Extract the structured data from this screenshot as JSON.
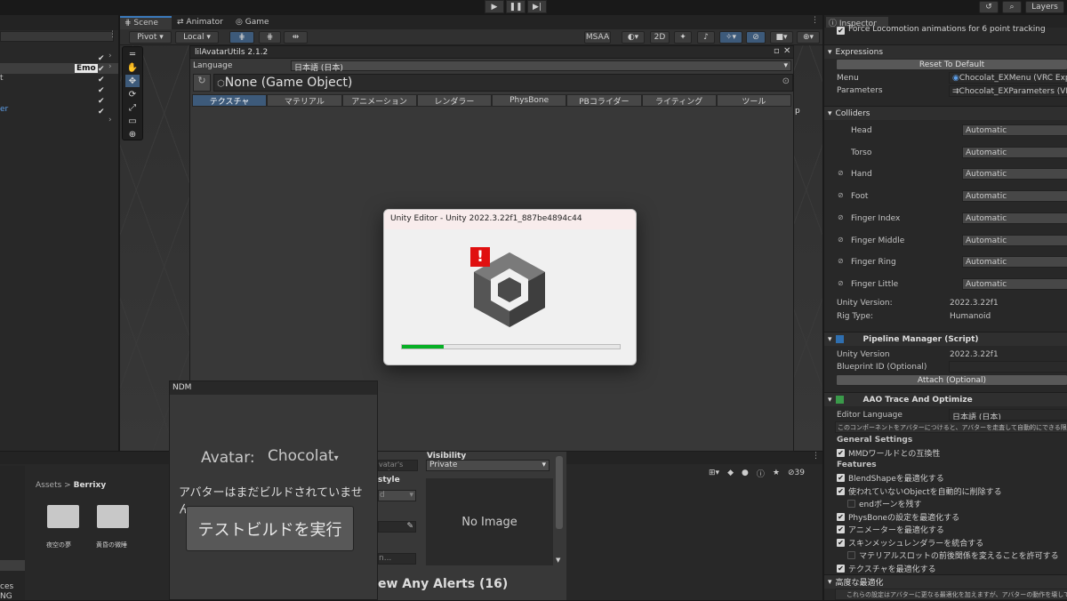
{
  "topbar": {
    "layers_label": "Layers",
    "play_icon": "play-icon",
    "pause_icon": "pause-icon",
    "step_icon": "step-icon"
  },
  "tabs": {
    "scene": "Scene",
    "animator": "Animator",
    "game": "Game",
    "inspector": "Inspector"
  },
  "scene_toolbar": {
    "pivot": "Pivot",
    "local": "Local",
    "msaa": "MSAA",
    "mode_2d": "2D",
    "visibility_count": "39"
  },
  "hierarchy": {
    "item_label": "Emo",
    "fragment_t": "t",
    "fragment_er": "er"
  },
  "lil": {
    "title": "lilAvatarUtils 2.1.2",
    "language_label": "Language",
    "language_value": "日本語 (日本)",
    "object_field": "None (Game Object)",
    "tabs": [
      "テクスチャ",
      "マテリアル",
      "アニメーション",
      "レンダラー",
      "PhysBone",
      "PBコライダー",
      "ライティング",
      "ツール"
    ],
    "selected_tab": 0
  },
  "dialog": {
    "title": "Unity Editor - Unity 2022.3.22f1_887be4894c44",
    "progress": 0.19,
    "alert_icon": "alert-icon",
    "logo": "unity-logo-icon"
  },
  "scene_fragments": {
    "p": "p"
  },
  "inspector": {
    "top_row": "Force Locomotion animations for 6 point tracking",
    "expressions": "Expressions",
    "reset_default": "Reset To Default",
    "menu_label": "Menu",
    "menu_value": "Chocolat_EXMenu (VRC Expre",
    "params_label": "Parameters",
    "params_value": "Chocolat_EXParameters (VRC",
    "colliders": "Colliders",
    "collider_rows": [
      {
        "label": "Head",
        "value": "Automatic"
      },
      {
        "label": "Torso",
        "value": "Automatic"
      },
      {
        "label": "Hand",
        "value": "Automatic"
      },
      {
        "label": "Foot",
        "value": "Automatic"
      },
      {
        "label": "Finger Index",
        "value": "Automatic"
      },
      {
        "label": "Finger Middle",
        "value": "Automatic"
      },
      {
        "label": "Finger Ring",
        "value": "Automatic"
      },
      {
        "label": "Finger Little",
        "value": "Automatic"
      }
    ],
    "unity_version_label": "Unity Version:",
    "unity_version_value": "2022.3.22f1",
    "rig_type_label": "Rig Type:",
    "rig_type_value": "Humanoid",
    "pipeline_title": "Pipeline Manager (Script)",
    "pm_unity_version_label": "Unity Version",
    "pm_unity_version_value": "2022.3.22f1",
    "blueprint_label": "Blueprint ID (Optional)",
    "attach_label": "Attach (Optional)",
    "aao_title": "AAO Trace And Optimize",
    "editor_language_label": "Editor Language",
    "editor_language_value": "日本語 (日本)",
    "aao_desc": "このコンポーネントをアバターにつけると、アバターを走査して自動的にできる限りの最適化を行",
    "general_settings": "General Settings",
    "mmd": "MMDワールドとの互換性",
    "features": "Features",
    "feature_items": [
      {
        "label": "BlendShapeを最適化する",
        "checked": true,
        "indent": false
      },
      {
        "label": "使われていないObjectを自動的に削除する",
        "checked": true,
        "indent": false
      },
      {
        "label": "endボーンを残す",
        "checked": false,
        "indent": true
      },
      {
        "label": "PhysBoneの設定を最適化する",
        "checked": true,
        "indent": false
      },
      {
        "label": "アニメーターを最適化する",
        "checked": true,
        "indent": false
      },
      {
        "label": "スキンメッシュレンダラーを統合する",
        "checked": true,
        "indent": false
      },
      {
        "label": "マテリアルスロットの前後関係を変えることを許可する",
        "checked": false,
        "indent": true
      },
      {
        "label": "テクスチャを最適化する",
        "checked": true,
        "indent": false
      }
    ],
    "advanced": "高度な最適化",
    "advanced_desc": "これらの設定はアバターに更なる最適化を加えますが、アバターの動作を壊して"
  },
  "ndm": {
    "title": "NDM",
    "avatar_label": "Avatar:",
    "avatar_value": "Chocolat",
    "not_built": "アバターはまだビルドされていません。",
    "test_build": "テストビルドを実行"
  },
  "vrc_panel": {
    "visibility_label": "Visibility",
    "visibility_value": "Private",
    "no_image": "No Image",
    "alerts": "ew Any Alerts (16)",
    "avatar_put": "vatar's put",
    "style": "style",
    "field_d": "d",
    "field_n": "n..."
  },
  "project": {
    "breadcrumb_root": "Assets",
    "breadcrumb_sep": ">",
    "breadcrumb_current": "Berrixy",
    "folders": [
      "夜空の夢",
      "黄昏の微睡"
    ],
    "side_fragments": [
      "ces",
      "NG"
    ]
  }
}
